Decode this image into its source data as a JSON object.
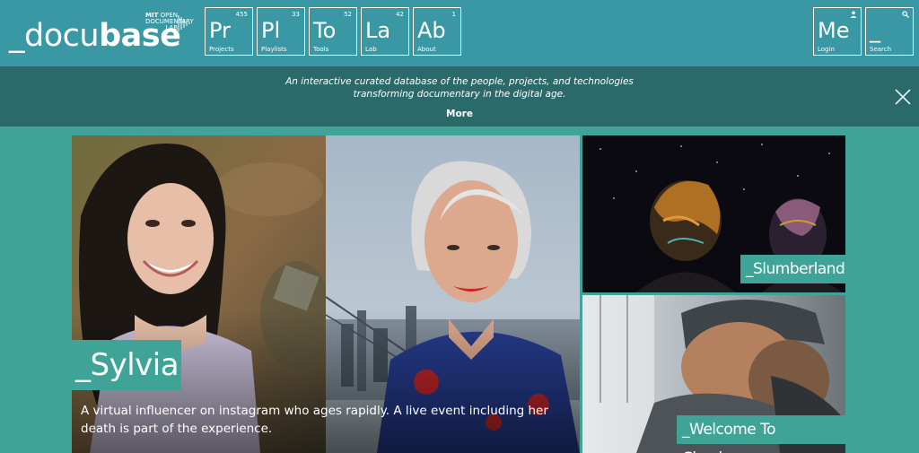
{
  "header": {
    "logo": {
      "underscore": "_",
      "docu": "docu",
      "base": "base"
    },
    "mit": {
      "line1": "MIT",
      "line1b": "OPEN",
      "line2": "DOCUMENTARY",
      "line3": "LAB"
    },
    "tiles": [
      {
        "symbol": "Pr",
        "count": "455",
        "label": "Projects"
      },
      {
        "symbol": "Pl",
        "count": "33",
        "label": "Playlists"
      },
      {
        "symbol": "To",
        "count": "52",
        "label": "Tools"
      },
      {
        "symbol": "La",
        "count": "42",
        "label": "Lab"
      },
      {
        "symbol": "Ab",
        "count": "1",
        "label": "About"
      }
    ],
    "login": {
      "symbol": "Me",
      "label": "Login",
      "icon": "user-icon"
    },
    "search": {
      "symbol": "_",
      "label": "Search",
      "icon": "search-icon"
    },
    "colors": {
      "header_bg": "#3a98a5",
      "banner_bg": "#2a6a6a",
      "accent": "#3fa397"
    }
  },
  "banner": {
    "tagline_line1": "An interactive curated database of the people, projects, and technologies",
    "tagline_line2": "transforming documentary in the digital age.",
    "more": "More",
    "close_icon": "close-icon"
  },
  "features": {
    "main": {
      "title": "_Sylvia",
      "description_line1": "A virtual influencer on instagram who ages rapidly. A live event including her",
      "description_line2": "death is part of the experience."
    },
    "side": [
      {
        "title": "_Slumberland"
      },
      {
        "title": "_Welcome To Chechnya"
      }
    ]
  }
}
